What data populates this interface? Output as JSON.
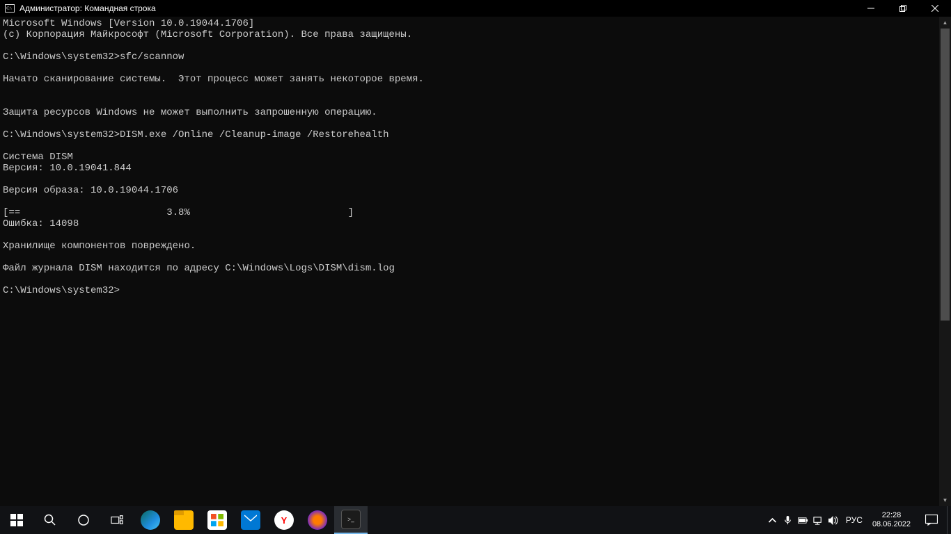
{
  "titlebar": {
    "title": "Администратор: Командная строка"
  },
  "console": {
    "lines": [
      "Microsoft Windows [Version 10.0.19044.1706]",
      "(c) Корпорация Майкрософт (Microsoft Corporation). Все права защищены.",
      "",
      "C:\\Windows\\system32>sfc/scannow",
      "",
      "Начато сканирование системы.  Этот процесс может занять некоторое время.",
      "",
      "",
      "Защита ресурсов Windows не может выполнить запрошенную операцию.",
      "",
      "C:\\Windows\\system32>DISM.exe /Online /Cleanup-image /Restorehealth",
      "",
      "Система DISM",
      "Версия: 10.0.19041.844",
      "",
      "Версия образа: 10.0.19044.1706",
      "",
      "[==                         3.8%                           ]",
      "Ошибка: 14098",
      "",
      "Хранилище компонентов повреждено.",
      "",
      "Файл журнала DISM находится по адресу C:\\Windows\\Logs\\DISM\\dism.log",
      "",
      "C:\\Windows\\system32>"
    ]
  },
  "taskbar": {
    "lang": "РУС",
    "time": "22:28",
    "date": "08.06.2022"
  }
}
